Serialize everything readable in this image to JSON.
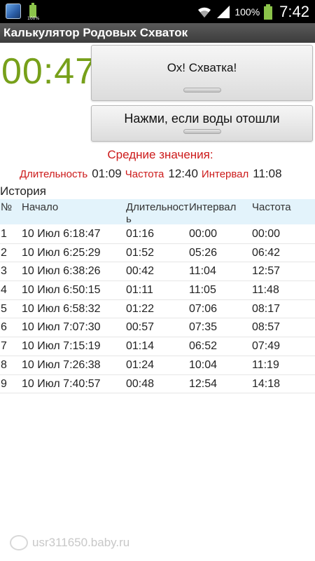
{
  "statusbar": {
    "battery_small_label": "100%",
    "battery_percent": "100%",
    "time": "7:42",
    "battery_color": "#8bc34a"
  },
  "app": {
    "title": "Калькулятор Родовых Схваток"
  },
  "timer": {
    "value": "00:47",
    "color": "#77a01a"
  },
  "buttons": {
    "contraction_label": "Ох! Схватка!",
    "waters_label": "Нажми, если воды отошли"
  },
  "averages": {
    "title": "Средние значения:",
    "duration_label": "Длительность",
    "duration_value": "01:09",
    "frequency_label": "Частота",
    "frequency_value": "12:40",
    "interval_label": "Интервал",
    "interval_value": "11:08",
    "label_color": "#cc1a1a"
  },
  "history": {
    "title": "История",
    "columns": [
      "№",
      "Начало",
      "Длительность",
      "Интервал",
      "Частота"
    ],
    "rows": [
      [
        "1",
        "10 Июл 6:18:47",
        "01:16",
        "00:00",
        "00:00"
      ],
      [
        "2",
        "10 Июл 6:25:29",
        "01:52",
        "05:26",
        "06:42"
      ],
      [
        "3",
        "10 Июл 6:38:26",
        "00:42",
        "11:04",
        "12:57"
      ],
      [
        "4",
        "10 Июл 6:50:15",
        "01:11",
        "11:05",
        "11:48"
      ],
      [
        "5",
        "10 Июл 6:58:32",
        "01:22",
        "07:06",
        "08:17"
      ],
      [
        "6",
        "10 Июл 7:07:30",
        "00:57",
        "07:35",
        "08:57"
      ],
      [
        "7",
        "10 Июл 7:15:19",
        "01:14",
        "06:52",
        "07:49"
      ],
      [
        "8",
        "10 Июл 7:26:38",
        "01:24",
        "10:04",
        "11:19"
      ],
      [
        "9",
        "10 Июл 7:40:57",
        "00:48",
        "12:54",
        "14:18"
      ]
    ],
    "header_bg": "#e3f3fb"
  },
  "watermark": {
    "text": "usr311650.baby.ru"
  }
}
